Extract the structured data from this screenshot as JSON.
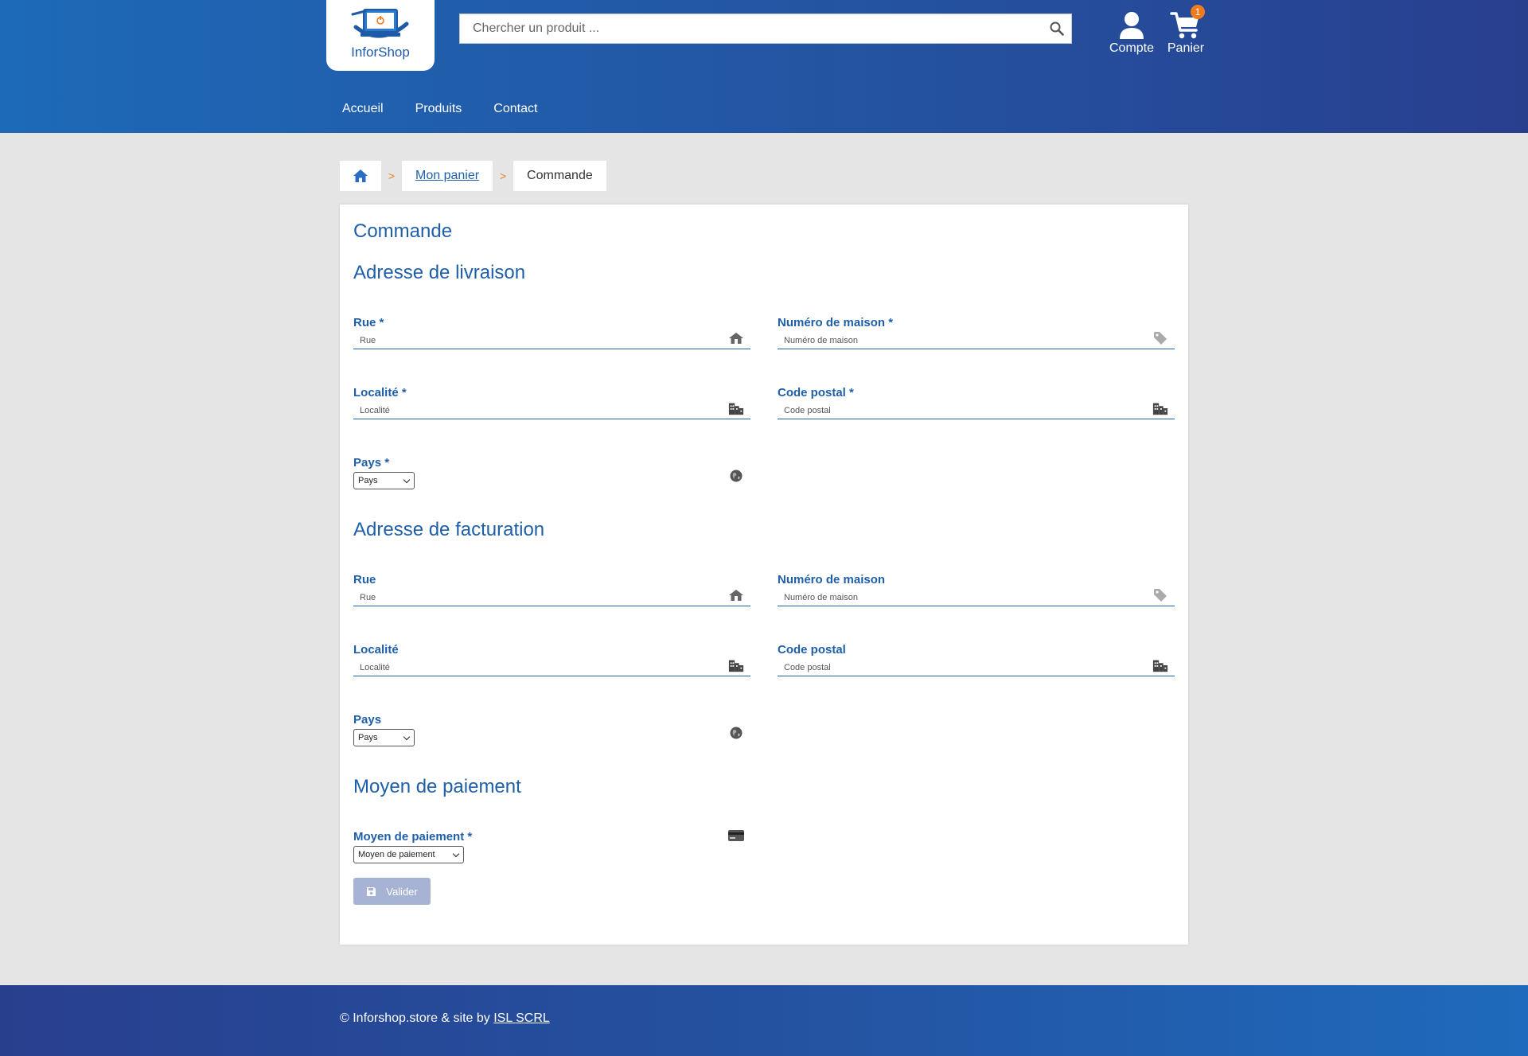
{
  "header": {
    "logo_text": "InforShop",
    "search_placeholder": "Chercher un produit ...",
    "account_label": "Compte",
    "cart_label": "Panier",
    "cart_count": "1",
    "nav": [
      "Accueil",
      "Produits",
      "Contact"
    ]
  },
  "breadcrumb": {
    "cart_link": "Mon panier",
    "current": "Commande",
    "separator": ">"
  },
  "page": {
    "title": "Commande",
    "delivery": {
      "heading": "Adresse de livraison",
      "street_label": "Rue *",
      "street_placeholder": "Rue",
      "house_label": "Numéro de maison *",
      "house_placeholder": "Numéro de maison",
      "city_label": "Localité *",
      "city_placeholder": "Localité",
      "zip_label": "Code postal *",
      "zip_placeholder": "Code postal",
      "country_label": "Pays *",
      "country_value": "Pays"
    },
    "billing": {
      "heading": "Adresse de facturation",
      "street_label": "Rue",
      "street_placeholder": "Rue",
      "house_label": "Numéro de maison",
      "house_placeholder": "Numéro de maison",
      "city_label": "Localité",
      "city_placeholder": "Localité",
      "zip_label": "Code postal",
      "zip_placeholder": "Code postal",
      "country_label": "Pays",
      "country_value": "Pays"
    },
    "payment": {
      "heading": "Moyen de paiement",
      "method_label": "Moyen de paiement *",
      "method_value": "Moyen de paiement"
    },
    "submit_label": "Valider"
  },
  "footer": {
    "text": "© Inforshop.store & site by",
    "link": "ISL SCRL"
  },
  "colors": {
    "accent": "#1f5fa8",
    "orange": "#f07b1d",
    "disabled_button": "#a7b3d4"
  }
}
